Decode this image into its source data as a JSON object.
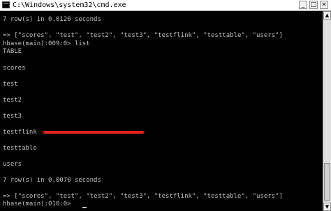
{
  "window": {
    "title": "C:\\Windows\\system32\\cmd.exe",
    "controls": {
      "minimize": "_",
      "maximize": "□",
      "close": "×"
    }
  },
  "console": {
    "lines": [
      "7 row(s) in 0.0120 seconds",
      "",
      "=> [\"scores\", \"test\", \"test2\", \"test3\", \"testflink\", \"testtable\", \"users\"]",
      "hbase(main):009:0> list",
      "TABLE",
      "",
      "scores",
      "",
      "test",
      "",
      "test2",
      "",
      "test3",
      "",
      "testflink",
      "",
      "testtable",
      "",
      "users",
      "",
      "7 row(s) in 0.0070 seconds",
      "",
      "=> [\"scores\", \"test\", \"test2\", \"test3\", \"testflink\", \"testtable\", \"users\"]",
      "hbase(main):010:0> "
    ]
  },
  "scrollbar": {
    "up_arrow": "▲",
    "down_arrow": "▼"
  },
  "colors": {
    "console_background": "#000000",
    "console_text": "#c0c0c0",
    "annotation_stroke": "#e8231e"
  }
}
